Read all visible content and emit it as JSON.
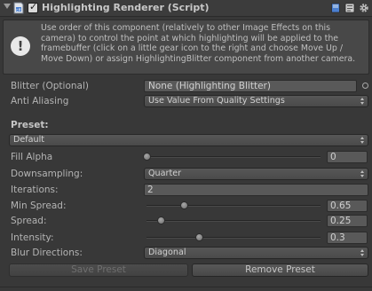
{
  "header": {
    "title": "Highlighting Renderer (Script)",
    "enabled": true
  },
  "helpbox": {
    "icon": "info-exclamation-icon",
    "text": "Use order of this component (relatively to other Image Effects on this camera) to control the point at which highlighting will be applied to the framebuffer (click on a little gear icon to the right and choose Move Up / Move Down) or assign HighlightingBlitter component from another camera."
  },
  "fields": {
    "blitter": {
      "label": "Blitter (Optional)",
      "value": "None (Highlighting Blitter)"
    },
    "anti_aliasing": {
      "label": "Anti Aliasing",
      "value": "Use Value From Quality Settings"
    },
    "preset_section": {
      "label": "Preset:"
    },
    "preset": {
      "value": "Default"
    },
    "fill_alpha": {
      "label": "Fill Alpha",
      "value": "0",
      "fraction": 0.0
    },
    "downsampling": {
      "label": "Downsampling:",
      "value": "Quarter"
    },
    "iterations": {
      "label": "Iterations:",
      "value": "2"
    },
    "min_spread": {
      "label": "Min Spread:",
      "value": "0.65",
      "fraction": 0.2
    },
    "spread": {
      "label": "Spread:",
      "value": "0.25",
      "fraction": 0.08
    },
    "intensity": {
      "label": "Intensity:",
      "value": "0.3",
      "fraction": 0.3
    },
    "blur_directions": {
      "label": "Blur Directions:",
      "value": "Diagonal"
    }
  },
  "buttons": {
    "save_preset": "Save Preset",
    "remove_preset": "Remove Preset"
  },
  "colors": {
    "background": "#383838",
    "script_icon": "#4a7fd0"
  }
}
